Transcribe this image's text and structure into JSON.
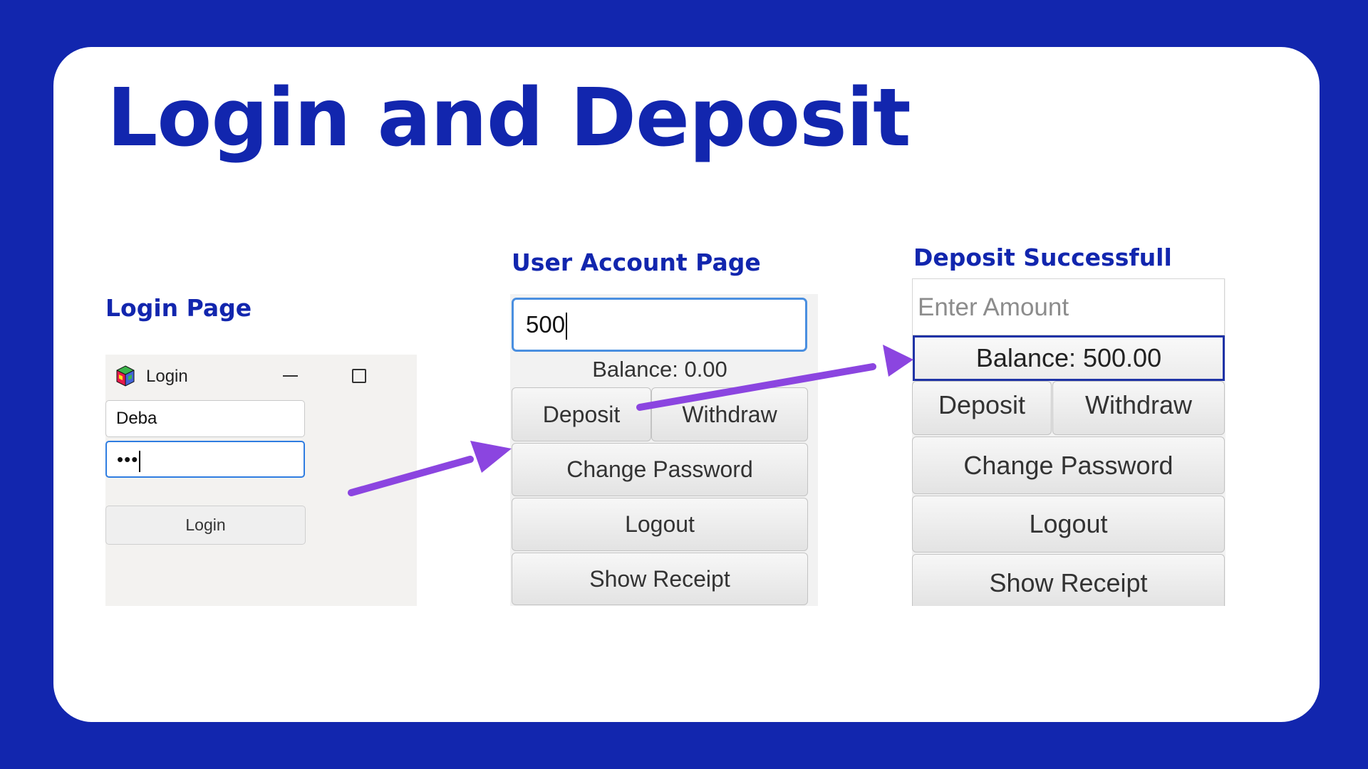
{
  "slide": {
    "title": "Login and Deposit",
    "accent_color": "#1226ae",
    "arrow_color": "#8b45e0"
  },
  "login_page": {
    "heading": "Login Page",
    "window": {
      "title": "Login",
      "app_icon": "cube-app-icon",
      "minimize_icon": "minimize-icon",
      "maximize_icon": "maximize-icon"
    },
    "username_value": "Deba",
    "password_value": "•••",
    "login_button": "Login"
  },
  "user_account_page": {
    "heading": "User Account Page",
    "amount_value": "500",
    "balance": "Balance: 0.00",
    "buttons": {
      "deposit": "Deposit",
      "withdraw": "Withdraw",
      "change_password": "Change Password",
      "logout": "Logout",
      "show_receipt": "Show Receipt"
    }
  },
  "deposit_success_page": {
    "heading": "Deposit Successfull",
    "amount_placeholder": "Enter Amount",
    "balance": "Balance: 500.00",
    "buttons": {
      "deposit": "Deposit",
      "withdraw": "Withdraw",
      "change_password": "Change Password",
      "logout": "Logout",
      "show_receipt": "Show Receipt"
    }
  }
}
